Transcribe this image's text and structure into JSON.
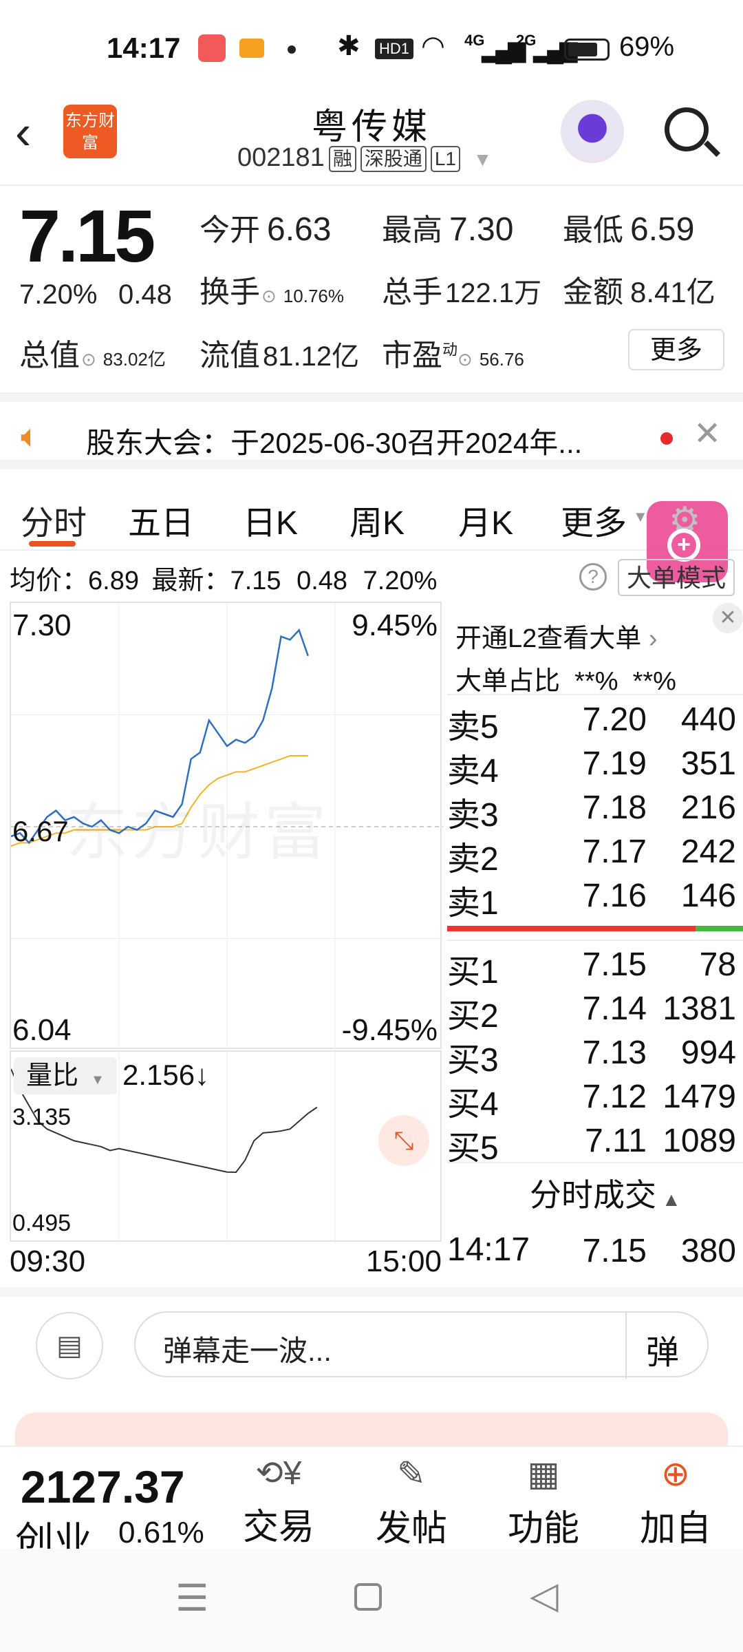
{
  "status_bar": {
    "time": "14:17",
    "battery": "69%",
    "net1": "4G",
    "net2": "2G",
    "hd": "HD1"
  },
  "header": {
    "brand": "东方财富",
    "title": "粤传媒",
    "code": "002181",
    "tags": [
      "融",
      "深股通",
      "L1"
    ]
  },
  "quote": {
    "price": "7.15",
    "change_pct": "7.20%",
    "change": "0.48",
    "open_label": "今开",
    "open": "6.63",
    "high_label": "最高",
    "high": "7.30",
    "low_label": "最低",
    "low": "6.59",
    "turnover_label": "换手",
    "turnover": "10.76%",
    "volume_label": "总手",
    "volume": "122.1万",
    "amount_label": "金额",
    "amount": "8.41亿",
    "mktcap_label": "总值",
    "mktcap": "83.02亿",
    "float_label": "流值",
    "float_cap": "81.12亿",
    "pe_label": "市盈",
    "pe_sup": "动",
    "pe": "56.76",
    "more": "更多"
  },
  "notice": {
    "text": "股东大会：于2025-06-30召开2024年..."
  },
  "tabs": [
    "分时",
    "五日",
    "日K",
    "周K",
    "月K",
    "更多"
  ],
  "avg_line": {
    "avg_label": "均价：",
    "avg": "6.89",
    "latest_label": "最新：",
    "latest": "7.15",
    "chg": "0.48",
    "pct": "7.20%"
  },
  "big_order_mode": "大单模式",
  "chart": {
    "ymax": "7.30",
    "ymid": "6.67",
    "ymin": "6.04",
    "pct_top": "9.45%",
    "pct_bot": "-9.45%",
    "watermark": "东方财富",
    "vol_label": "量比",
    "vol_value": "2.156↓",
    "vol_max": "3.135",
    "vol_min": "0.495",
    "time_start": "09:30",
    "time_end": "15:00"
  },
  "chart_data": {
    "type": "line",
    "price": [
      6.64,
      6.65,
      6.62,
      6.66,
      6.7,
      6.72,
      6.69,
      6.7,
      6.68,
      6.67,
      6.69,
      6.66,
      6.65,
      6.67,
      6.66,
      6.68,
      6.72,
      6.71,
      6.7,
      6.74,
      6.88,
      6.9,
      7.0,
      6.96,
      6.92,
      6.94,
      6.93,
      6.95,
      7.0,
      7.1,
      7.26,
      7.25,
      7.28,
      7.2
    ],
    "avg": [
      6.61,
      6.62,
      6.62,
      6.63,
      6.64,
      6.65,
      6.65,
      6.66,
      6.66,
      6.66,
      6.66,
      6.66,
      6.66,
      6.66,
      6.66,
      6.66,
      6.67,
      6.67,
      6.67,
      6.68,
      6.73,
      6.77,
      6.8,
      6.82,
      6.83,
      6.84,
      6.84,
      6.85,
      6.86,
      6.87,
      6.88,
      6.89,
      6.89,
      6.89
    ],
    "vol_ratio": [
      3.135,
      2.6,
      2.2,
      1.8,
      1.6,
      1.5,
      1.4,
      1.3,
      1.25,
      1.2,
      1.15,
      1.05,
      1.1,
      1.05,
      1.0,
      0.95,
      0.9,
      0.85,
      0.8,
      0.75,
      0.7,
      0.65,
      0.6,
      0.55,
      0.5,
      0.495,
      0.8,
      1.3,
      1.5,
      1.52,
      1.55,
      1.6,
      1.8,
      2.0,
      2.156
    ],
    "ylim": [
      6.04,
      7.3
    ],
    "ref": 6.67
  },
  "order_book": {
    "link": "开通L2查看大单",
    "big_ratio": "大单占比  **%  **%",
    "sells": [
      {
        "label": "卖5",
        "price": "7.20",
        "qty": "440"
      },
      {
        "label": "卖4",
        "price": "7.19",
        "qty": "351"
      },
      {
        "label": "卖3",
        "price": "7.18",
        "qty": "216"
      },
      {
        "label": "卖2",
        "price": "7.17",
        "qty": "242"
      },
      {
        "label": "卖1",
        "price": "7.16",
        "qty": "146"
      }
    ],
    "buys": [
      {
        "label": "买1",
        "price": "7.15",
        "qty": "78"
      },
      {
        "label": "买2",
        "price": "7.14",
        "qty": "1381"
      },
      {
        "label": "买3",
        "price": "7.13",
        "qty": "994"
      },
      {
        "label": "买4",
        "price": "7.12",
        "qty": "1479"
      },
      {
        "label": "买5",
        "price": "7.11",
        "qty": "1089"
      }
    ],
    "trades_title": "分时成交",
    "last_trade": {
      "time": "14:17",
      "price": "7.15",
      "qty": "380"
    }
  },
  "danmu": {
    "placeholder": "弹幕走一波...",
    "send": "弹"
  },
  "bottom_nav": {
    "index_value": "2127.37",
    "index_name": "创业",
    "index_pct": "0.61%",
    "items": [
      "交易",
      "发帖",
      "功能",
      "加自"
    ]
  }
}
